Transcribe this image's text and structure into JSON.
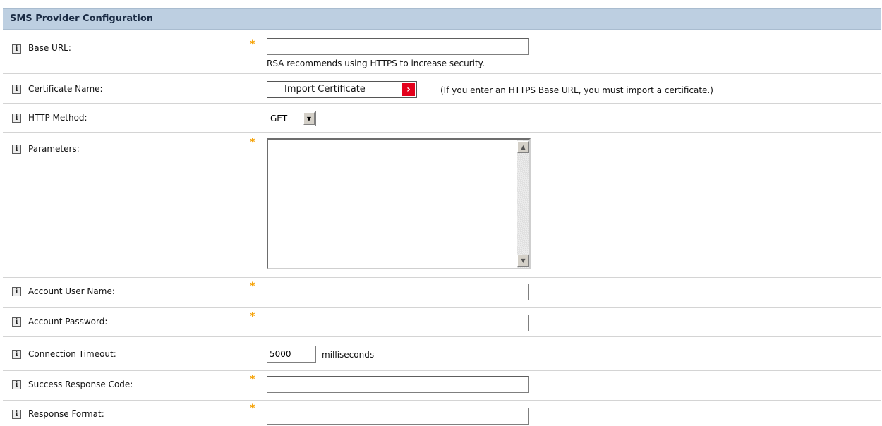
{
  "header": {
    "title": "SMS Provider Configuration"
  },
  "info_glyph": "i",
  "required_mark": "*",
  "fields": {
    "base_url": {
      "label": "Base URL:",
      "value": "",
      "hint": "RSA recommends using HTTPS to increase security."
    },
    "certificate": {
      "label": "Certificate Name:",
      "button_label": "Import Certificate",
      "button_icon": "red-arrow-icon",
      "note": "(If you enter an HTTPS Base URL, you must import a certificate.)"
    },
    "http_method": {
      "label": "HTTP Method:",
      "selected": "GET"
    },
    "parameters": {
      "label": "Parameters:",
      "value": ""
    },
    "account_user_name": {
      "label": "Account User Name:",
      "value": ""
    },
    "account_password": {
      "label": "Account Password:",
      "value": ""
    },
    "connection_timeout": {
      "label": "Connection Timeout:",
      "value": "5000",
      "unit": "milliseconds"
    },
    "success_response_code": {
      "label": "Success Response Code:",
      "value": ""
    },
    "response_format": {
      "label": "Response Format:",
      "value": ""
    }
  },
  "colors": {
    "header_bg": "#bdcfe1",
    "required": "#f5a000",
    "button_accent": "#e3001b"
  }
}
